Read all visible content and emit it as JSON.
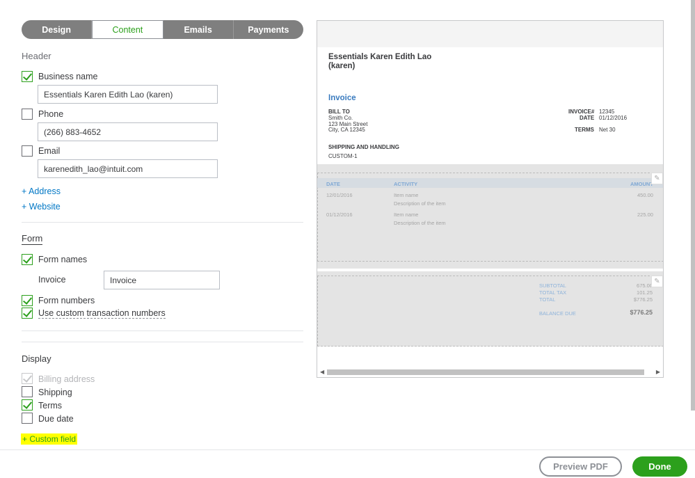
{
  "tabs": [
    {
      "label": "Design"
    },
    {
      "label": "Content"
    },
    {
      "label": "Emails"
    },
    {
      "label": "Payments"
    }
  ],
  "header": {
    "title": "Header",
    "business_name": {
      "label": "Business name",
      "value": "Essentials Karen Edith Lao (karen)"
    },
    "phone": {
      "label": "Phone",
      "value": "(266) 883-4652"
    },
    "email": {
      "label": "Email",
      "value": "karenedith_lao@intuit.com"
    },
    "add_address": "+ Address",
    "add_website": "+ Website"
  },
  "form": {
    "title": "Form",
    "form_names_label": "Form names",
    "invoice_label": "Invoice",
    "invoice_value": "Invoice",
    "form_numbers_label": "Form numbers",
    "custom_numbers_label": "Use custom transaction numbers"
  },
  "display": {
    "title": "Display",
    "billing_address": "Billing address",
    "shipping": "Shipping",
    "terms": "Terms",
    "due_date": "Due date",
    "custom_field": "+ Custom field"
  },
  "preview": {
    "company_line1": "Essentials Karen Edith Lao",
    "company_line2": "(karen)",
    "doc_title": "Invoice",
    "bill_to_label": "BILL TO",
    "bill_to_lines": [
      "Smith Co.",
      "123 Main Street",
      "City, CA 12345"
    ],
    "invoice_no_label": "INVOICE#",
    "invoice_no": "12345",
    "date_label": "DATE",
    "date": "01/12/2016",
    "terms_label": "TERMS",
    "terms": "Net 30",
    "shipping_label": "SHIPPING AND HANDLING",
    "shipping_value": "CUSTOM-1",
    "table_headers": {
      "date": "DATE",
      "activity": "ACTIVITY",
      "amount": "AMOUNT"
    },
    "rows": [
      {
        "date": "12/01/2016",
        "item": "Item name",
        "desc": "Description of the item",
        "amount": "450.00"
      },
      {
        "date": "01/12/2016",
        "item": "Item name",
        "desc": "Description of the item",
        "amount": "225.00"
      }
    ],
    "subtotal_label": "SUBTOTAL",
    "subtotal": "675.00",
    "tax_label": "TOTAL TAX",
    "tax": "101.25",
    "total_label": "TOTAL",
    "total": "$776.25",
    "balance_label": "BALANCE DUE",
    "balance": "$776.25"
  },
  "footer": {
    "preview_pdf": "Preview PDF",
    "done": "Done"
  },
  "colors": {
    "accent": "#2ca01c",
    "link": "#0077c5",
    "invoice_blue": "#3a7bbf",
    "highlight": "#ffff00"
  }
}
